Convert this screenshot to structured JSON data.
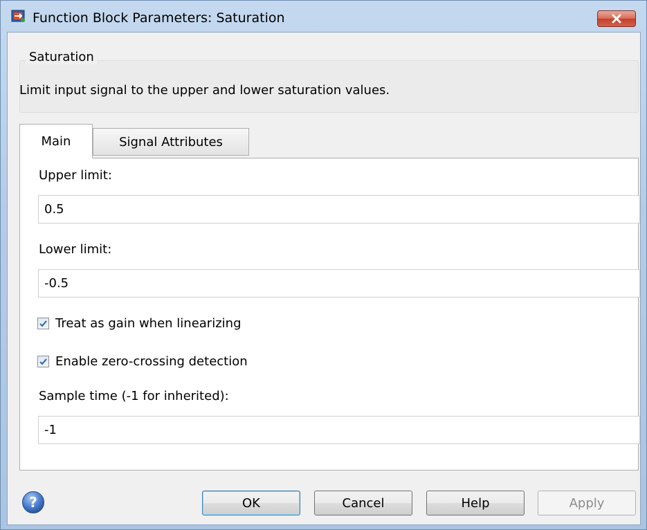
{
  "window": {
    "title": "Function Block Parameters: Saturation",
    "close_label": "✕"
  },
  "description": {
    "legend": "Saturation",
    "text": "Limit input signal to the upper and lower saturation values."
  },
  "tabs": [
    {
      "label": "Main",
      "active": true
    },
    {
      "label": "Signal Attributes",
      "active": false
    }
  ],
  "main": {
    "upper_limit": {
      "label": "Upper limit:",
      "value": "0.5"
    },
    "lower_limit": {
      "label": "Lower limit:",
      "value": "-0.5"
    },
    "treat_as_gain": {
      "label": "Treat as gain when linearizing",
      "checked": true
    },
    "zero_crossing": {
      "label": "Enable zero-crossing detection",
      "checked": true
    },
    "sample_time": {
      "label": "Sample time (-1 for inherited):",
      "value": "-1"
    }
  },
  "buttons": {
    "ok": "OK",
    "cancel": "Cancel",
    "help": "Help",
    "apply": "Apply"
  },
  "icons": {
    "app": "simulink-block-icon",
    "help": "help-question-icon",
    "close": "close-icon",
    "check": "checkmark-icon"
  },
  "colors": {
    "close_button": "#c5402a",
    "ok_border": "#3c7fb1",
    "help_icon": "#3a6fc4"
  }
}
